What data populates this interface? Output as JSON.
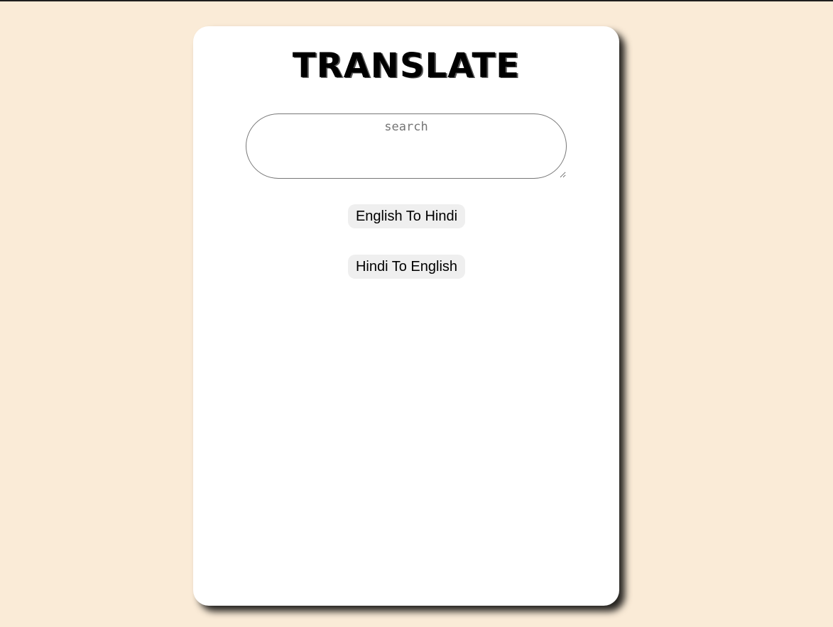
{
  "app": {
    "title": "TRANSLATE"
  },
  "search": {
    "placeholder": "search",
    "value": ""
  },
  "buttons": {
    "english_to_hindi": "English To Hindi",
    "hindi_to_english": "Hindi To English"
  },
  "colors": {
    "page_background": "#faebd7",
    "card_background": "#ffffff",
    "button_background": "#efefef"
  }
}
